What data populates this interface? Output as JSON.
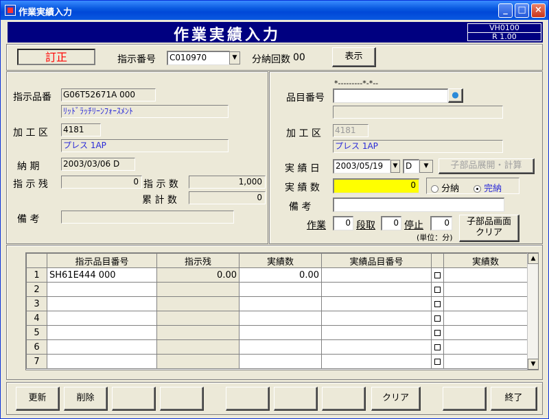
{
  "window": {
    "title": "作業実績入力",
    "minimize": "_",
    "maximize": "□",
    "close": "×"
  },
  "header": {
    "title": "作業実績入力",
    "version_top": "VH0100",
    "version_bottom": "R 1.00"
  },
  "top": {
    "mode": "訂正",
    "order_label": "指示番号",
    "order_value": "C010970",
    "delivery_count_label": "分納回数",
    "delivery_count_value": "00",
    "show_button": "表示"
  },
  "left": {
    "item_label": "指示品番",
    "item_code": "G06T52671A  000",
    "item_name": "ﾘｯﾄﾞﾗｯﾁﾘｰﾝﾌｫｰｽﾒﾝﾄ",
    "process_label": "加 工 区",
    "process_code": "4181",
    "process_name": "プレス  1AP",
    "due_label": "納  期",
    "due_value": "2003/03/06 D",
    "remain_label": "指 示 残",
    "remain_value": "0",
    "order_qty_label": "指 示 数",
    "order_qty_value": "1,000",
    "cumulative_label": "累 計 数",
    "cumulative_value": "0",
    "remarks_label": "備  考",
    "remarks_value": ""
  },
  "right": {
    "pattern": "*---------*-*--",
    "part_label": "品目番号",
    "part_value": "",
    "part_name": "",
    "process_label": "加 工 区",
    "process_code": "4181",
    "process_name": "プレス  1AP",
    "date_label": "実 績 日",
    "date_value": "2003/05/19",
    "shift_value": "D",
    "expand_button": "子部品展開・計算",
    "qty_label": "実 績 数",
    "qty_value": "0",
    "radio_partial": "分納",
    "radio_complete": "完納",
    "remarks_label": "備  考",
    "remarks_value": "",
    "work_label": "作業",
    "work_value": "0",
    "setup_label": "段取",
    "setup_value": "0",
    "stop_label": "停止",
    "stop_value": "0",
    "unit_note": "(単位：分)",
    "clear_child_line1": "子部品画面",
    "clear_child_line2": "クリア"
  },
  "grid": {
    "headers": [
      "指示品目番号",
      "指示残",
      "実績数",
      "実績品目番号",
      "",
      "実績数"
    ],
    "rows": [
      {
        "no": "1",
        "item": "SH61E444     000",
        "remain": "0.00",
        "qty": "0.00",
        "result_item": "",
        "result_qty": ""
      },
      {
        "no": "2",
        "item": "",
        "remain": "",
        "qty": "",
        "result_item": "",
        "result_qty": ""
      },
      {
        "no": "3",
        "item": "",
        "remain": "",
        "qty": "",
        "result_item": "",
        "result_qty": ""
      },
      {
        "no": "4",
        "item": "",
        "remain": "",
        "qty": "",
        "result_item": "",
        "result_qty": ""
      },
      {
        "no": "5",
        "item": "",
        "remain": "",
        "qty": "",
        "result_item": "",
        "result_qty": ""
      },
      {
        "no": "6",
        "item": "",
        "remain": "",
        "qty": "",
        "result_item": "",
        "result_qty": ""
      },
      {
        "no": "7",
        "item": "",
        "remain": "",
        "qty": "",
        "result_item": "",
        "result_qty": ""
      }
    ]
  },
  "footer": {
    "update": "更新",
    "delete": "削除",
    "clear": "クリア",
    "exit": "終了"
  },
  "colors": {
    "header_bg": "#000080",
    "qty_highlight": "#ffff00",
    "mode_text": "#ff0000",
    "link_blue": "#2a2ad8"
  }
}
